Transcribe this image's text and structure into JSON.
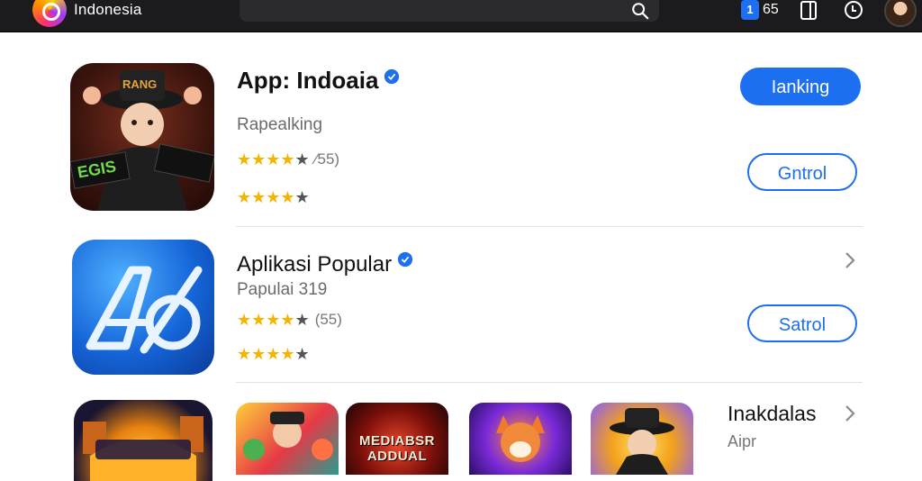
{
  "topbar": {
    "brand": "Indonesia",
    "badge": "1",
    "count": "65",
    "icons": [
      "logo-icon",
      "search-icon",
      "bookmark-icon",
      "clock-icon",
      "avatar"
    ]
  },
  "rows": [
    {
      "title": "App: Indoaia",
      "subtitle": "Rapealking",
      "rating_text": "⁄55)",
      "rating_stars": 4.5,
      "rating2_stars": 4,
      "icon_text_top": "RANG",
      "icon_text_bottom": "EGIS",
      "buttons": [
        "Ianking",
        "Gntrol"
      ]
    },
    {
      "title": "Aplikasi Popular",
      "subtitle": "Papulai 319",
      "rating_text": "(55)",
      "rating_stars": 4.5,
      "rating2_stars": 4,
      "icon_text": "AO",
      "buttons": [
        "Satrol"
      ]
    }
  ],
  "section": {
    "title": "Inakdalas",
    "subtitle": "Aipr",
    "games": [
      "",
      "MEDIABSR\nADDUAL",
      "",
      ""
    ]
  },
  "colors": {
    "accent": "#1d6ff2",
    "topbar": "#1b1b1d",
    "star": "#f5b400"
  }
}
